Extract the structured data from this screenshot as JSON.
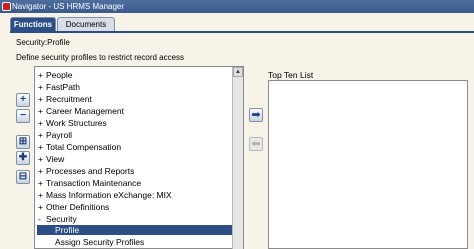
{
  "window": {
    "title": "Navigator - US HRMS Manager"
  },
  "tabs": [
    {
      "label": "Functions",
      "active": true
    },
    {
      "label": "Documents",
      "active": false
    }
  ],
  "breadcrumb": "Security:Profile",
  "description": "Define security profiles to restrict record access",
  "side_buttons": [
    {
      "name": "expand-button",
      "icon": "plus-icon",
      "glyph": "+"
    },
    {
      "name": "collapse-button",
      "icon": "minus-icon",
      "glyph": "−"
    },
    {
      "name": "expand-branch-button",
      "icon": "expand-branch-icon",
      "glyph": "⊞"
    },
    {
      "name": "expand-all-button",
      "icon": "expand-all-icon",
      "glyph": "✚"
    },
    {
      "name": "collapse-all-button",
      "icon": "collapse-all-icon",
      "glyph": "⊟"
    }
  ],
  "tree": {
    "items": [
      {
        "mark": "+",
        "label": "People"
      },
      {
        "mark": "+",
        "label": "FastPath"
      },
      {
        "mark": "+",
        "label": "Recruitment"
      },
      {
        "mark": "+",
        "label": "Career Management"
      },
      {
        "mark": "+",
        "label": "Work Structures"
      },
      {
        "mark": "+",
        "label": "Payroll"
      },
      {
        "mark": "+",
        "label": "Total Compensation"
      },
      {
        "mark": "+",
        "label": "View"
      },
      {
        "mark": "+",
        "label": "Processes and Reports"
      },
      {
        "mark": "+",
        "label": "Transaction Maintenance"
      },
      {
        "mark": "+",
        "label": "Mass Information eXchange: MIX"
      },
      {
        "mark": "+",
        "label": "Other Definitions"
      },
      {
        "mark": "-",
        "label": "Security"
      },
      {
        "mark": "",
        "label": "Profile",
        "selected": true
      },
      {
        "mark": "",
        "label": "Assign Security Profiles"
      }
    ]
  },
  "move_buttons": [
    {
      "name": "add-to-top-ten-button",
      "icon": "arrow-right-icon",
      "glyph": "➡",
      "enabled": true
    },
    {
      "name": "remove-from-top-ten-button",
      "icon": "arrow-left-icon",
      "glyph": "⬅",
      "enabled": false
    }
  ],
  "top_ten": {
    "label": "Top Ten List",
    "items": []
  },
  "colors": {
    "accent": "#2c4e86",
    "background": "#f7f3e8",
    "titlebar": "#3a5a8c"
  }
}
